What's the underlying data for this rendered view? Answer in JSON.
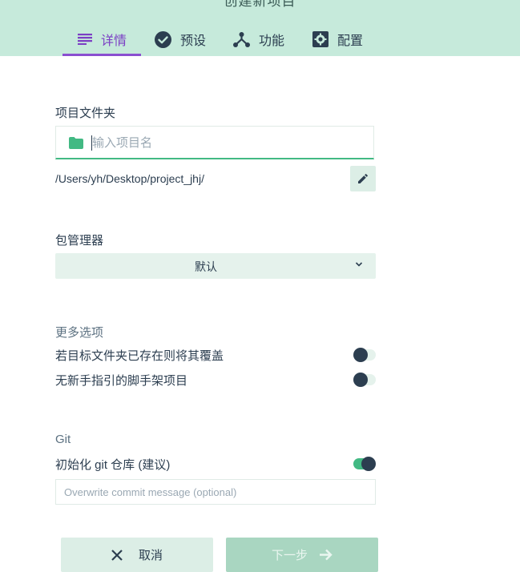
{
  "header": {
    "title": "创建新项目",
    "tabs": [
      {
        "label": "详情",
        "icon": "details-icon",
        "active": true
      },
      {
        "label": "预设",
        "icon": "check-circle-icon",
        "active": false
      },
      {
        "label": "功能",
        "icon": "fork-icon",
        "active": false
      },
      {
        "label": "配置",
        "icon": "gear-icon",
        "active": false
      }
    ],
    "accent": "#8a4fd0",
    "background": "#c6eadb"
  },
  "project_folder": {
    "label": "项目文件夹",
    "input_placeholder": "输入项目名",
    "input_value": "",
    "path": "/Users/yh/Desktop/project_jhj/"
  },
  "package_manager": {
    "label": "包管理器",
    "selected": "默认"
  },
  "more_options": {
    "title": "更多选项",
    "items": [
      {
        "label": "若目标文件夹已存在则将其覆盖",
        "enabled": false
      },
      {
        "label": "无新手指引的脚手架项目",
        "enabled": false
      }
    ]
  },
  "git": {
    "title": "Git",
    "init_label": "初始化 git 仓库 (建议)",
    "init_enabled": true,
    "commit_placeholder": "Overwrite commit message (optional)",
    "commit_value": ""
  },
  "actions": {
    "cancel_label": "取消",
    "next_label": "下一步"
  },
  "colors": {
    "primary": "#42b983",
    "text": "#2c3e50"
  }
}
